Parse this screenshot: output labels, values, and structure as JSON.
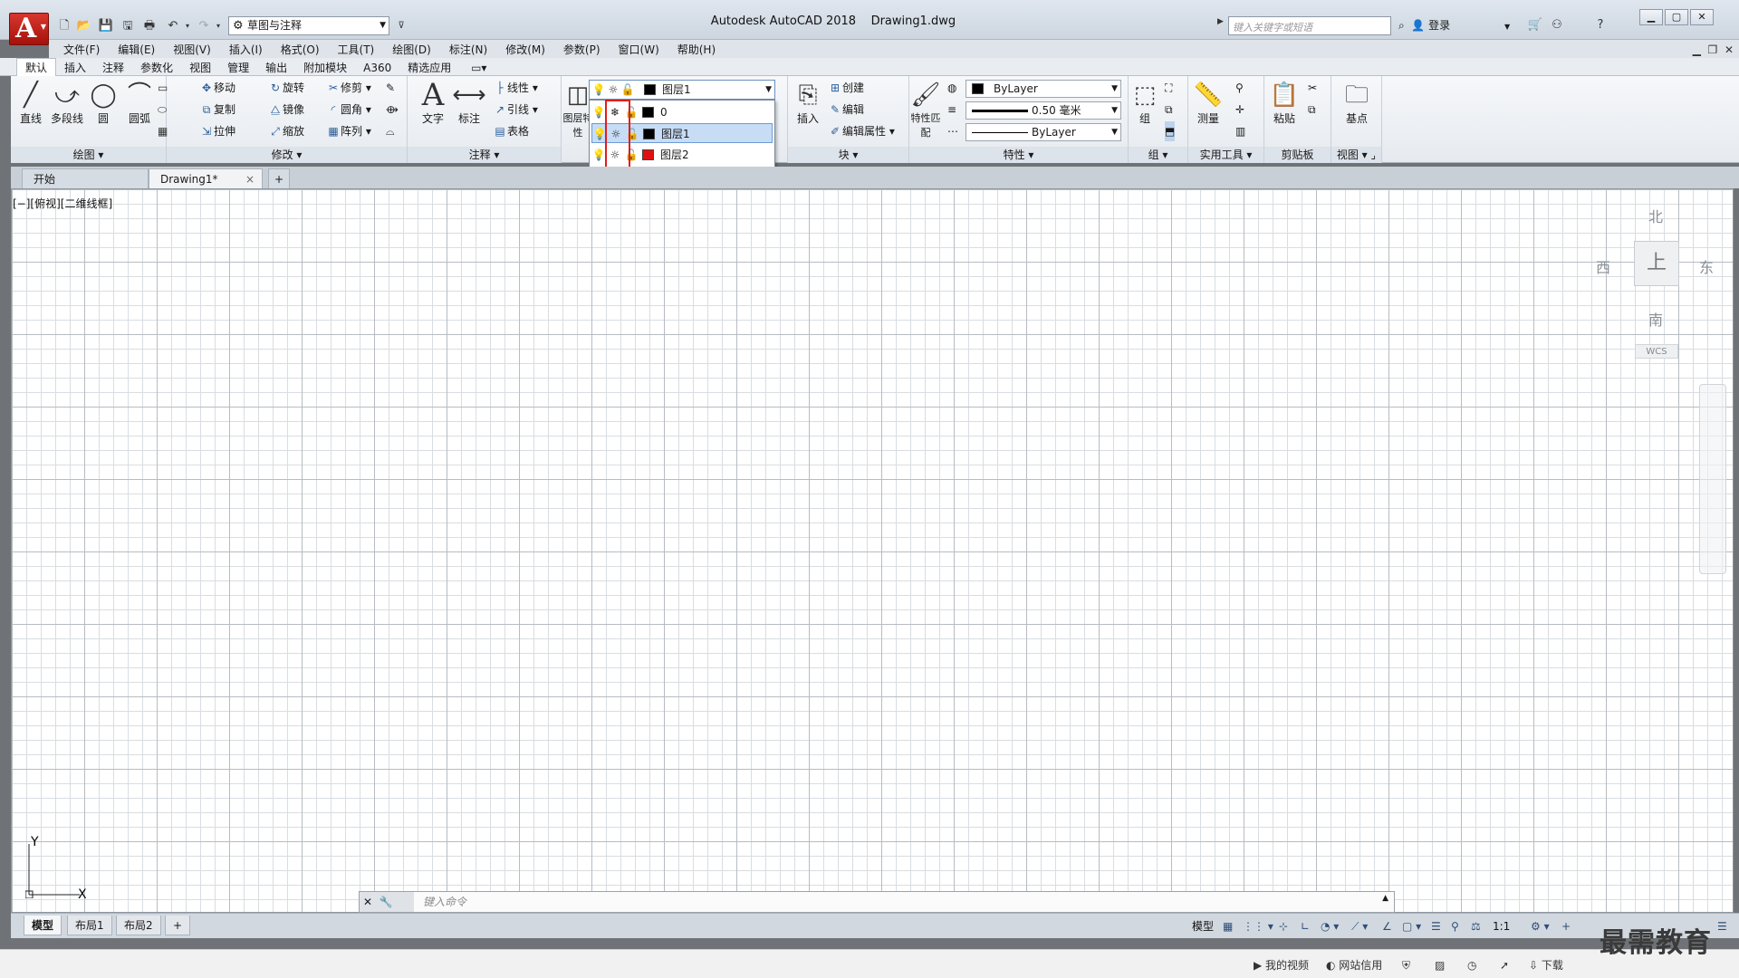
{
  "window": {
    "title": "Autodesk AutoCAD 2018",
    "document": "Drawing1.dwg",
    "app_letter": "A",
    "workspace": "草图与注释",
    "search_placeholder": "键入关键字或短语",
    "signin": "登录"
  },
  "menu": [
    "文件(F)",
    "编辑(E)",
    "视图(V)",
    "插入(I)",
    "格式(O)",
    "工具(T)",
    "绘图(D)",
    "标注(N)",
    "修改(M)",
    "参数(P)",
    "窗口(W)",
    "帮助(H)"
  ],
  "ribbon_tabs": [
    "默认",
    "插入",
    "注释",
    "参数化",
    "视图",
    "管理",
    "输出",
    "附加模块",
    "A360",
    "精选应用"
  ],
  "draw_panel": {
    "title": "绘图",
    "big": [
      "直线",
      "多段线",
      "圆",
      "圆弧"
    ]
  },
  "modify_panel": {
    "title": "修改",
    "tools": [
      "移动",
      "旋转",
      "修剪",
      "复制",
      "镜像",
      "圆角",
      "拉伸",
      "缩放",
      "阵列"
    ]
  },
  "annotation_panel": {
    "title": "注释",
    "big": [
      "文字",
      "标注"
    ],
    "small": [
      "线性",
      "引线",
      "表格"
    ]
  },
  "layers_panel": {
    "big": "图层特性",
    "current": "图层1",
    "list": [
      {
        "name": "0",
        "color": "#000000"
      },
      {
        "name": "图层1",
        "color": "#000000"
      },
      {
        "name": "图层2",
        "color": "#e01010"
      }
    ]
  },
  "block_panel": {
    "title": "块",
    "big": "插入",
    "small": [
      "创建",
      "编辑",
      "编辑属性"
    ]
  },
  "properties_panel": {
    "title": "特性",
    "big": "特性匹配",
    "color": "ByLayer",
    "lineweight": "0.50 毫米",
    "linetype": "ByLayer"
  },
  "group_panel": {
    "title": "组",
    "big": "组"
  },
  "utilities_panel": {
    "title": "实用工具",
    "big": "测量"
  },
  "clipboard_panel": {
    "title": "剪贴板",
    "big": "粘贴"
  },
  "view_panel": {
    "title": "视图",
    "big": "基点"
  },
  "doc_tabs": [
    "开始",
    "Drawing1*"
  ],
  "viewport_label": "[−][俯视][二维线框]",
  "viewcube": {
    "north": "北",
    "south": "南",
    "east": "东",
    "west": "西",
    "face": "上",
    "wcs": "WCS"
  },
  "ucs": {
    "x": "X",
    "y": "Y"
  },
  "command": {
    "placeholder": "键入命令"
  },
  "layout_tabs": [
    "模型",
    "布局1",
    "布局2"
  ],
  "status": {
    "model": "模型",
    "scale": "1:1"
  },
  "host_bar": [
    "我的视频",
    "网站信用",
    "下载"
  ],
  "watermark": "最需教育"
}
